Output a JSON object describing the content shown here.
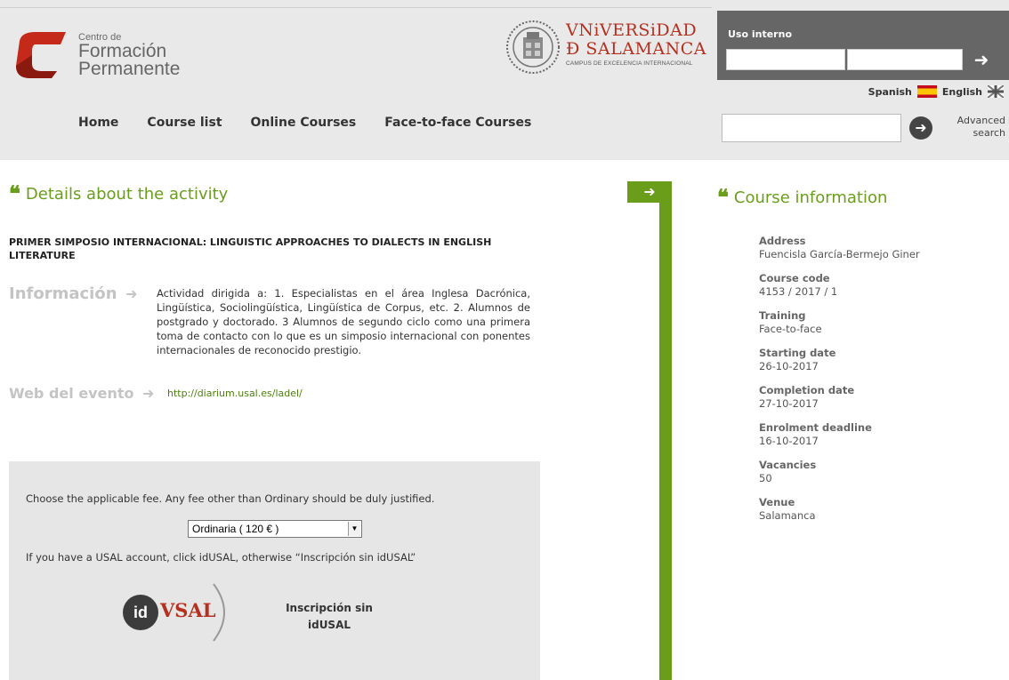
{
  "header": {
    "logo": {
      "small": "Centro de",
      "line1": "Formación",
      "line2": "Permanente"
    },
    "university": {
      "line1": "VNiVERSiDAD",
      "line2": "Ð SALAMANCA",
      "sub": "CAMPUS DE EXCELENCIA INTERNACIONAL"
    },
    "login": {
      "title": "Uso interno"
    },
    "languages": {
      "spanish": "Spanish",
      "english": "English"
    },
    "nav": [
      "Home",
      "Course list",
      "Online Courses",
      "Face-to-face Courses"
    ],
    "advanced_search": "Advanced search"
  },
  "details": {
    "title": "Details about the activity",
    "activity_title": "PRIMER SIMPOSIO INTERNACIONAL: LINGUISTIC APPROACHES TO DIALECTS IN ENGLISH LITERATURE",
    "info_label": "Información",
    "info_text": "Actividad dirigida a: 1. Especialistas en el área Inglesa Dacrónica, Lingüística, Sociolingüística, Lingüística de Corpus, etc. 2. Alumnos de postgrado y doctorado. 3 Alumnos de segundo ciclo como una primera toma de contacto con lo que es un simposio internacional con ponentes internacionales de reconocido prestigio.",
    "web_label": "Web del evento",
    "web_link": "http://diarium.usal.es/ladel/"
  },
  "fee": {
    "instruction": "Choose the applicable fee. Any fee other than Ordinary should be duly justified.",
    "selected": "Ordinaria ( 120 € )",
    "account_text": "If you have a USAL account, click idUSAL, otherwise “Inscripción sin idUSAL”",
    "idusal_id": "id",
    "idusal_vsal": "VSAL",
    "no_idusal": "Inscripción sin idUSAL"
  },
  "course": {
    "title": "Course information",
    "items": [
      {
        "label": "Address",
        "value": "Fuencisla García-Bermejo Giner"
      },
      {
        "label": "Course code",
        "value": "4153 / 2017 / 1"
      },
      {
        "label": "Training",
        "value": "Face-to-face"
      },
      {
        "label": "Starting date",
        "value": "26-10-2017"
      },
      {
        "label": "Completion date",
        "value": "27-10-2017"
      },
      {
        "label": "Enrolment deadline",
        "value": "16-10-2017"
      },
      {
        "label": "Vacancies",
        "value": "50"
      },
      {
        "label": "Venue",
        "value": "Salamanca"
      }
    ]
  },
  "colors": {
    "accent_green": "#6a9e1a",
    "usal_red": "#b5301f",
    "header_bg": "#e9e9e9",
    "login_bg": "#666666"
  },
  "icons": [
    "arrow-right-icon",
    "quote-icon",
    "flag-es-icon",
    "flag-uk-icon"
  ]
}
